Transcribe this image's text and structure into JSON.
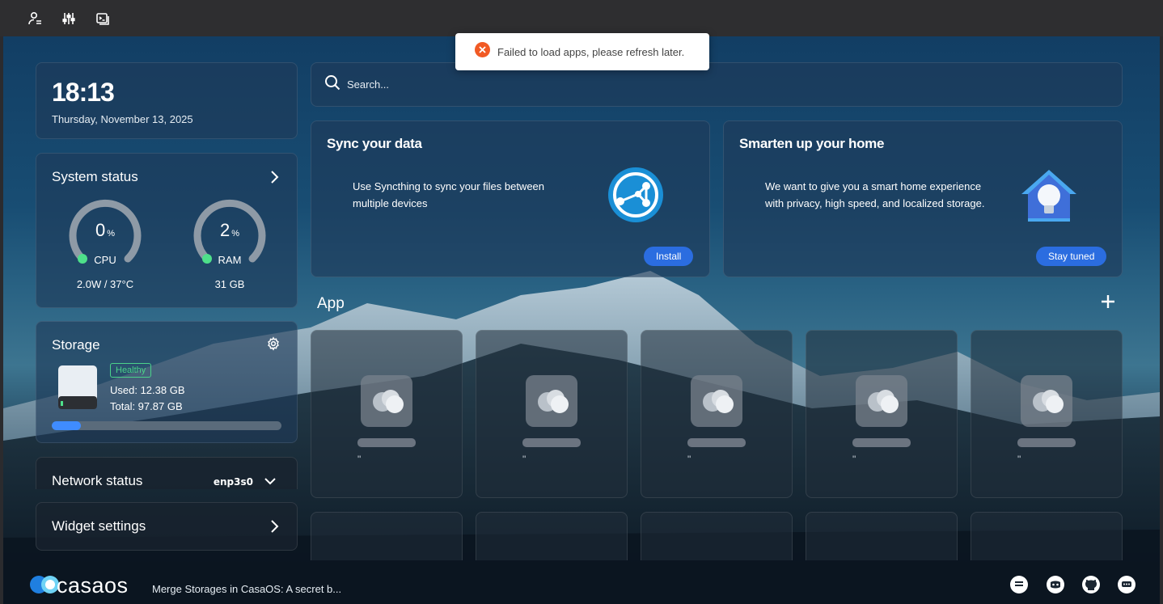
{
  "topbar": {
    "icons": [
      "user-settings-icon",
      "sliders-icon",
      "terminal-icon"
    ]
  },
  "toast": {
    "message": "Failed to load apps, please refresh later.",
    "icon": "error-icon",
    "color": "#f15a24"
  },
  "clock": {
    "time": "18:13",
    "date": "Thursday, November 13, 2025"
  },
  "system_status": {
    "title": "System status",
    "cpu": {
      "value": "0",
      "unit": "%",
      "label": "CPU",
      "detail": "2.0W / 37°C",
      "percent": 0
    },
    "ram": {
      "value": "2",
      "unit": "%",
      "label": "RAM",
      "detail": "31 GB",
      "percent": 2
    }
  },
  "storage": {
    "title": "Storage",
    "badge": "Healthy",
    "used": "Used: 12.38 GB",
    "total": "Total: 97.87 GB",
    "usage_fraction": 0.1265
  },
  "network": {
    "title": "Network status",
    "interface": "enp3s0"
  },
  "widget_settings": {
    "title": "Widget settings"
  },
  "search": {
    "placeholder": "Search..."
  },
  "promos": [
    {
      "title": "Sync your data",
      "description": "Use Syncthing to sync your files between multiple devices",
      "button": "Install",
      "icon": "syncthing-icon"
    },
    {
      "title": "Smarten up your home",
      "description": "We want to give you a smart home experience with privacy, high speed, and localized storage.",
      "button": "Stay tuned",
      "icon": "smart-home-icon"
    }
  ],
  "apps": {
    "title": "App",
    "placeholder_mark": "\""
  },
  "bottom": {
    "logo_text": "casaos",
    "news": "Merge Storages in CasaOS: A secret b..."
  },
  "colors": {
    "accent": "#2b6de0",
    "healthy": "#4bd28a",
    "gauge_dot": "#4ee08a"
  }
}
